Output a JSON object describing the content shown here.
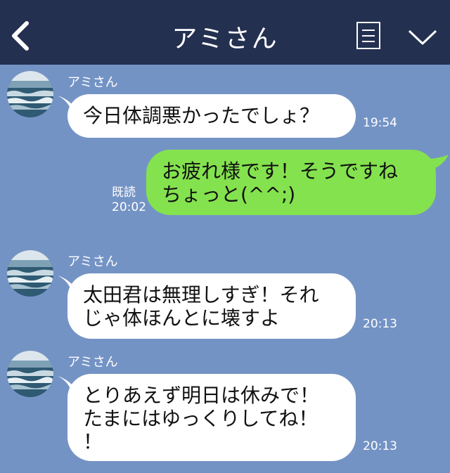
{
  "header": {
    "title": "アミさん"
  },
  "messages": [
    {
      "sender": "アミさん",
      "lines": [
        "今日体調悪かったでしょ？"
      ],
      "time": "19:54"
    },
    {
      "lines": [
        "お疲れ様です！そうですね",
        "ちょっと(^^;)"
      ],
      "read": "既読",
      "time": "20:02"
    },
    {
      "sender": "アミさん",
      "lines": [
        "太田君は無理しすぎ！それ",
        "じゃ体ほんとに壊すよ"
      ],
      "time": "20:13"
    },
    {
      "sender": "アミさん",
      "lines": [
        "とりあえず明日は休みで！",
        "たまにはゆっくりしてね！",
        "！"
      ],
      "time": "20:13"
    }
  ],
  "colors": {
    "header": "#243050",
    "background": "#7493c5",
    "outgoing_bubble": "#84e24e",
    "incoming_bubble": "#ffffff"
  },
  "icons": [
    "back-chevron-icon",
    "menu-icon",
    "chevron-down-icon"
  ]
}
